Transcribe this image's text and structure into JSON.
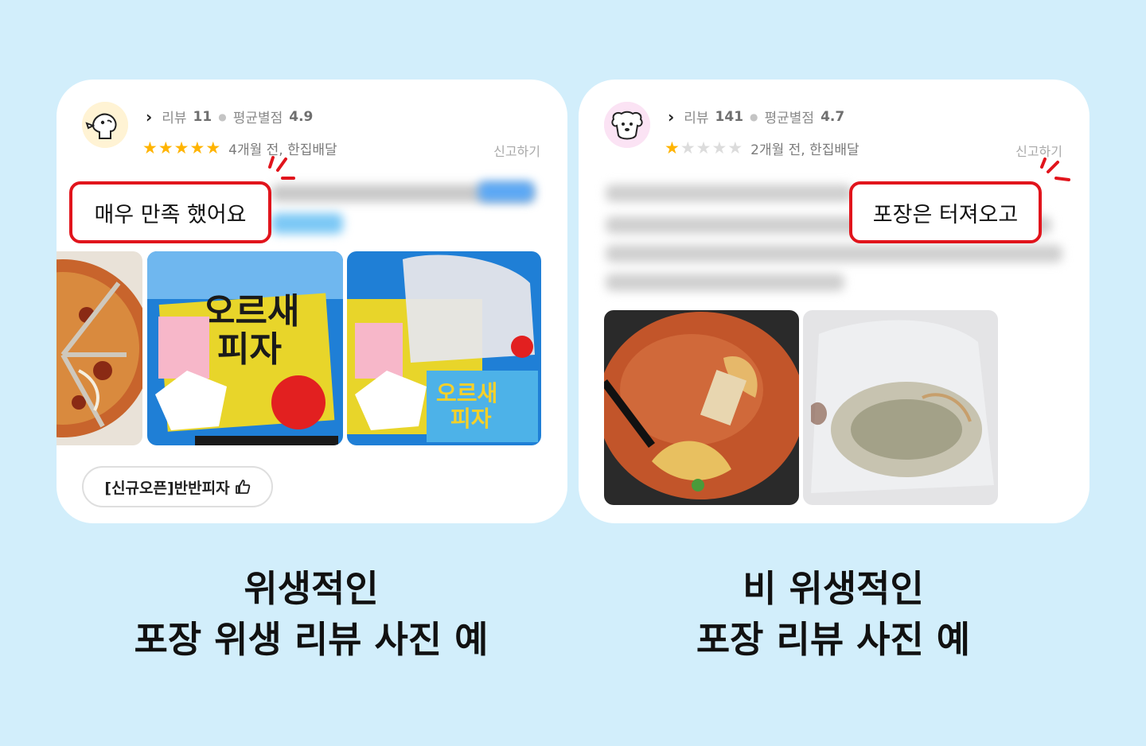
{
  "colors": {
    "background": "#d2eefb",
    "card": "#ffffff",
    "callout_border": "#e1141c",
    "star_on": "#ffb400",
    "star_off": "#dcdcdc"
  },
  "left_review": {
    "review_label": "리뷰",
    "review_count": "11",
    "avg_label": "평균별점",
    "avg_rating": "4.9",
    "stars": 5,
    "date_text": "4개월 전, 한집배달",
    "report": "신고하기",
    "callout": "매우 만족 했어요",
    "tag": "[신규오픈]반반피자",
    "tag_icon": "thumbs-up-icon",
    "photos": [
      "pizza-photo",
      "pizza-box-photo",
      "pizza-box-bag-photo"
    ]
  },
  "right_review": {
    "review_label": "리뷰",
    "review_count": "141",
    "avg_label": "평균별점",
    "avg_rating": "4.7",
    "stars": 1,
    "date_text": "2개월 전, 한집배달",
    "report": "신고하기",
    "callout": "포장은 터져오고",
    "photos": [
      "stew-photo",
      "leaked-bag-photo"
    ]
  },
  "captions": {
    "left_line1": "위생적인",
    "left_line2": "포장 위생 리뷰 사진 예",
    "right_line1": "비 위생적인",
    "right_line2": "포장 리뷰 사진 예"
  }
}
